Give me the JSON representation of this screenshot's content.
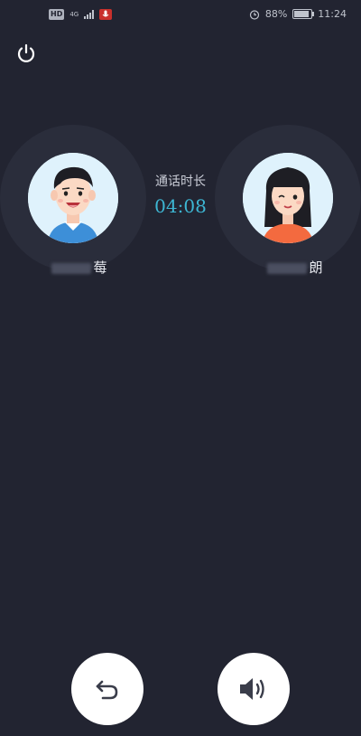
{
  "status_bar": {
    "hd_badge": "HD",
    "network": "4G",
    "battery_text": "88%",
    "battery_level": 0.88,
    "time": "11:24"
  },
  "call": {
    "duration_label": "通话时长",
    "duration_value": "04:08"
  },
  "left_user": {
    "name_visible": "莓"
  },
  "right_user": {
    "name_visible": "朗"
  },
  "icons": {
    "power": "power-icon",
    "back": "undo-icon",
    "speaker": "speaker-icon"
  },
  "colors": {
    "background": "#222431",
    "accent": "#3db6d3",
    "mic_badge": "#c9302c"
  }
}
